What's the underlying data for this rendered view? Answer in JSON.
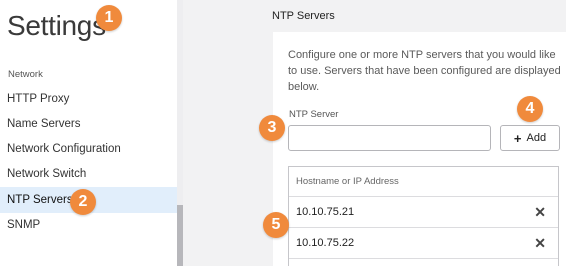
{
  "sidebar": {
    "title": "Settings",
    "section_label": "Network",
    "items": [
      {
        "label": "HTTP Proxy"
      },
      {
        "label": "Name Servers"
      },
      {
        "label": "Network Configuration"
      },
      {
        "label": "Network Switch"
      },
      {
        "label": "NTP Servers",
        "active": true
      },
      {
        "label": "SNMP"
      }
    ]
  },
  "main": {
    "header": "NTP Servers",
    "description": "Configure one or more NTP servers that you would like to use. Servers that have been configured are displayed below.",
    "field_label": "NTP Server",
    "input_value": "",
    "add_button_label": "Add",
    "table": {
      "header": "Hostname or IP Address",
      "rows": [
        {
          "address": "10.10.75.21"
        },
        {
          "address": "10.10.75.22"
        }
      ]
    }
  },
  "badges": [
    "1",
    "2",
    "3",
    "4",
    "5"
  ],
  "colors": {
    "badge": "#f08a3c",
    "active_item_bg": "#e1eefb",
    "active_indicator": "#2a8ad4"
  },
  "icons": {
    "add": "plus-icon",
    "delete": "close-icon"
  }
}
